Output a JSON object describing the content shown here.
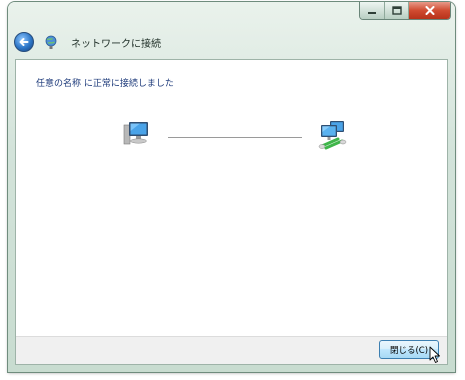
{
  "window": {
    "title": "ネットワークに接続",
    "status_message": "任意の名称 に正常に接続しました",
    "close_button_label": "閉じる(C)"
  },
  "icons": {
    "back": "back-arrow-icon",
    "network": "network-icon",
    "local_computer": "computer-icon",
    "network_computer": "connected-network-computer-icon",
    "minimize": "minimize-icon",
    "maximize": "maximize-icon",
    "close": "close-icon",
    "cursor": "mouse-pointer-icon"
  },
  "colors": {
    "status_text": "#1d3a7a",
    "close_caption": "#c94a33",
    "connection_accent": "#3fb54a"
  }
}
